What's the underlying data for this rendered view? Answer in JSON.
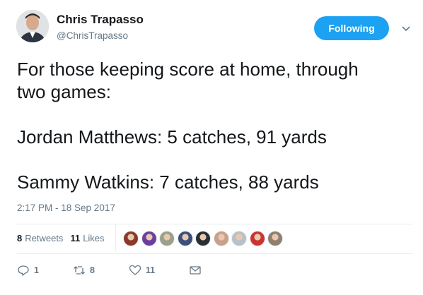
{
  "author": {
    "name": "Chris Trapasso",
    "handle": "@ChrisTrapasso"
  },
  "follow_button": {
    "label": "Following",
    "color": "#1da1f2"
  },
  "tweet": {
    "lines": [
      "For those keeping score at home, through\ntwo games:",
      "Jordan Matthews: 5 catches, 91 yards",
      "Sammy Watkins: 7 catches, 88 yards"
    ],
    "timestamp": "2:17 PM - 18 Sep 2017"
  },
  "stats": {
    "retweets_count": "8",
    "retweets_label": "Retweets",
    "likes_count": "11",
    "likes_label": "Likes"
  },
  "likers": [
    {
      "icon": "avatar",
      "color": "#8b3a2a"
    },
    {
      "icon": "avatar",
      "color": "#6b3fa0"
    },
    {
      "icon": "avatar",
      "color": "#9aa08a"
    },
    {
      "icon": "avatar",
      "color": "#3b4f7a"
    },
    {
      "icon": "avatar",
      "color": "#2a2f36"
    },
    {
      "icon": "avatar",
      "color": "#c9a089"
    },
    {
      "icon": "avatar",
      "color": "#b8c0c8"
    },
    {
      "icon": "avatar",
      "color": "#cc3333"
    },
    {
      "icon": "avatar",
      "color": "#8f7f6f"
    }
  ],
  "actions": {
    "reply_count": "1",
    "retweet_count": "8",
    "like_count": "11",
    "icons": [
      "reply-icon",
      "retweet-icon",
      "heart-icon",
      "message-icon"
    ]
  }
}
